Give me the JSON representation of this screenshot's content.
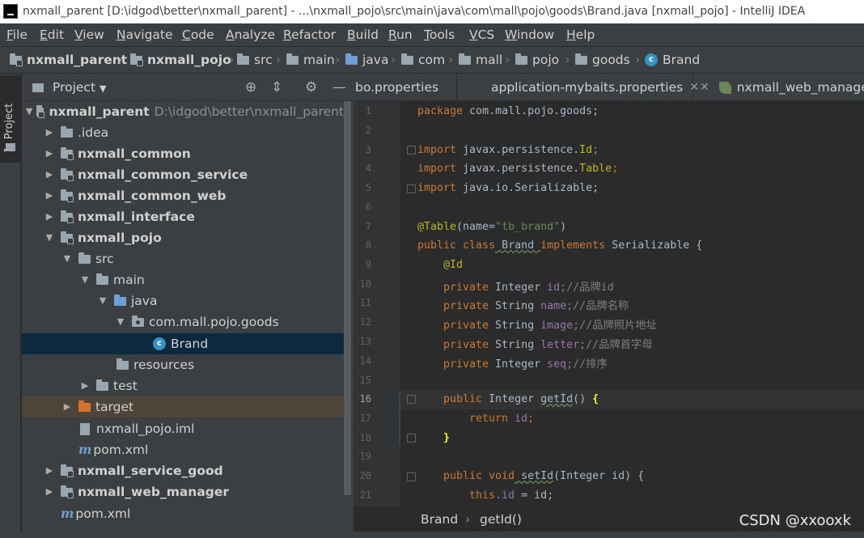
{
  "window": {
    "title": "nxmall_parent [D:\\idgod\\better\\nxmall_parent] - ...\\nxmall_pojo\\src\\main\\java\\com\\mall\\pojo\\goods\\Brand.java [nxmall_pojo] - IntelliJ IDEA"
  },
  "menu": [
    "File",
    "Edit",
    "View",
    "Navigate",
    "Code",
    "Analyze",
    "Refactor",
    "Build",
    "Run",
    "Tools",
    "VCS",
    "Window",
    "Help"
  ],
  "breadcrumb": [
    "nxmall_parent",
    "nxmall_pojo",
    "src",
    "main",
    "java",
    "com",
    "mall",
    "pojo",
    "goods",
    "Brand"
  ],
  "side_tab": "1: Project",
  "project_panel": {
    "title": "Project"
  },
  "tree": [
    {
      "label": "nxmall_parent",
      "path": "D:\\idgod\\better\\nxmall_parent"
    },
    {
      "label": ".idea"
    },
    {
      "label": "nxmall_common"
    },
    {
      "label": "nxmall_common_service"
    },
    {
      "label": "nxmall_common_web"
    },
    {
      "label": "nxmall_interface"
    },
    {
      "label": "nxmall_pojo"
    },
    {
      "label": "src"
    },
    {
      "label": "main"
    },
    {
      "label": "java"
    },
    {
      "label": "com.mall.pojo.goods"
    },
    {
      "label": "Brand"
    },
    {
      "label": "resources"
    },
    {
      "label": "test"
    },
    {
      "label": "target"
    },
    {
      "label": "nxmall_pojo.iml"
    },
    {
      "label": "pom.xml"
    },
    {
      "label": "nxmall_service_good"
    },
    {
      "label": "nxmall_web_manager"
    },
    {
      "label": "pom.xml"
    }
  ],
  "tabs": [
    "bo.properties",
    "application-mybaits.properties",
    "nxmall_web_manager\\...\\"
  ],
  "code": {
    "line_numbers": [
      "1",
      "2",
      "3",
      "4",
      "5",
      "6",
      "7",
      "8",
      "9",
      "10",
      "11",
      "12",
      "13",
      "14",
      "15",
      "16",
      "17",
      "18",
      "19",
      "20",
      "21"
    ],
    "l1_kw": "package",
    "l1_rest": " com.mall.pojo.goods;",
    "l3_kw": "import",
    "l3_rest": " javax.persistence.",
    "l3_end": "Id",
    "l4_kw": "import",
    "l4_rest": " javax.persistence.",
    "l4_end": "Table",
    "l5_kw": "import",
    "l5_rest": " java.io.Serializable;",
    "l7_an": "@Table",
    "l7_a": "(name=",
    "l7_str": "\"tb_brand\"",
    "l7_b": ")",
    "l8_kw1": "public class",
    "l8_cls": " Brand ",
    "l8_kw2": "implements",
    "l8_rest": " Serializable {",
    "l9_an": "@Id",
    "l10_kw": "private",
    "l10_ty": " Integer ",
    "l10_f": "id",
    "l10_cm": ";//品牌id",
    "l11_kw": "private",
    "l11_ty": " String ",
    "l11_f": "name",
    "l11_cm": ";//品牌名称",
    "l12_kw": "private",
    "l12_ty": " String ",
    "l12_f": "image",
    "l12_cm": ";//品牌照片地址",
    "l13_kw": "private",
    "l13_ty": " String ",
    "l13_f": "letter",
    "l13_cm": ";//品牌首字母",
    "l14_kw": "private",
    "l14_ty": " Integer ",
    "l14_f": "seq",
    "l14_cm": ";//排序",
    "l16_kw": "public",
    "l16_ty": " Integer ",
    "l16_m": "getId",
    "l16_p": "() ",
    "l16_br": "{",
    "l17_kw": "return",
    "l17_f": " id",
    "l18_br": "}",
    "l20_kw": "public void",
    "l20_m": " setId",
    "l20_p": "(Integer id) {",
    "l21_kw": "this",
    "l21_f": ".id",
    "l21_rest": " = id;"
  },
  "editor_breadcrumb": [
    "Brand",
    "getId()"
  ],
  "watermark": "CSDN @xxooxk"
}
